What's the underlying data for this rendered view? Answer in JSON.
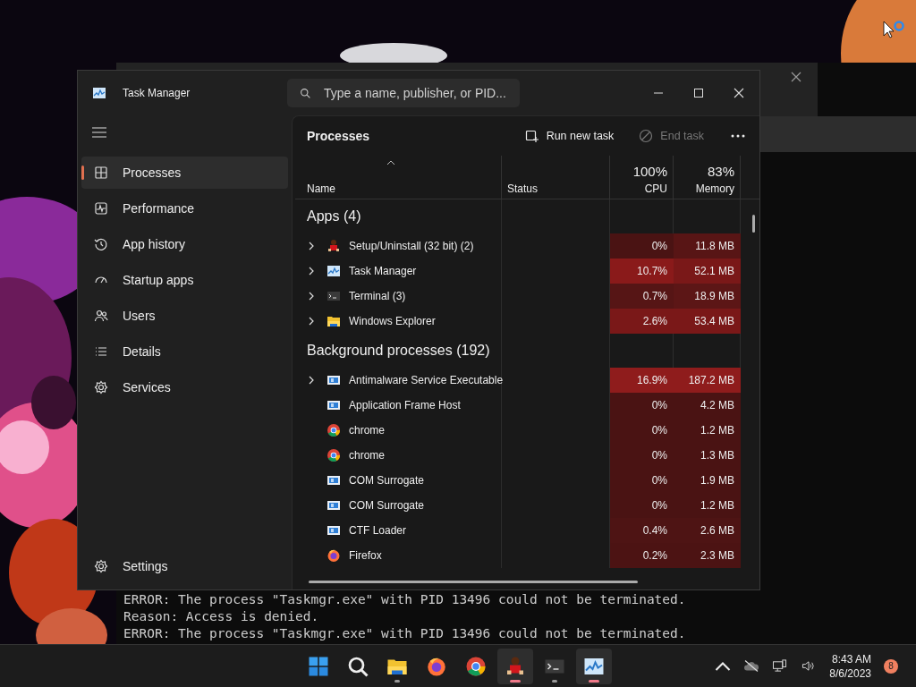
{
  "terminal": {
    "lines": [
      "ERROR: The process \"Taskmgr.exe\" with PID 13496 could not be terminated.",
      "Reason: Access is denied.",
      "ERROR: The process \"Taskmgr.exe\" with PID 13496 could not be terminated."
    ]
  },
  "task_manager": {
    "title": "Task Manager",
    "search": {
      "placeholder": "Type a name, publisher, or PID..."
    },
    "sidebar": {
      "items": [
        {
          "kind": "processes",
          "label": "Processes",
          "selected": true
        },
        {
          "kind": "performance",
          "label": "Performance",
          "selected": false
        },
        {
          "kind": "history",
          "label": "App history",
          "selected": false
        },
        {
          "kind": "startup",
          "label": "Startup apps",
          "selected": false
        },
        {
          "kind": "users",
          "label": "Users",
          "selected": false
        },
        {
          "kind": "details",
          "label": "Details",
          "selected": false
        },
        {
          "kind": "services",
          "label": "Services",
          "selected": false
        }
      ],
      "settings": "Settings"
    },
    "page_title": "Processes",
    "toolbar": [
      {
        "kind": "run",
        "label": "Run new task",
        "disabled": false
      },
      {
        "kind": "end",
        "label": "End task",
        "disabled": true
      }
    ],
    "table": {
      "columns": [
        "Name",
        "Status",
        "CPU",
        "Memory"
      ],
      "cpu_total": "100%",
      "memory_total": "83%",
      "groups": [
        {
          "title": "Apps (4)",
          "rows": [
            {
              "kind": "setup",
              "name": "Setup/Uninstall (32 bit) (2)",
              "expandable": true,
              "cpu": {
                "value": "0%",
                "color": "#4a1313"
              },
              "memory": {
                "value": "11.8 MB",
                "color": "#581515"
              }
            },
            {
              "kind": "taskmgr",
              "name": "Task Manager",
              "expandable": true,
              "cpu": {
                "value": "10.7%",
                "color": "#8a1a1a"
              },
              "memory": {
                "value": "52.1 MB",
                "color": "#7a1818"
              }
            },
            {
              "kind": "terminal",
              "name": "Terminal (3)",
              "expandable": true,
              "cpu": {
                "value": "0.7%",
                "color": "#561515"
              },
              "memory": {
                "value": "18.9 MB",
                "color": "#5c1616"
              }
            },
            {
              "kind": "folder",
              "name": "Windows Explorer",
              "expandable": true,
              "cpu": {
                "value": "2.6%",
                "color": "#7a1818"
              },
              "memory": {
                "value": "53.4 MB",
                "color": "#7a1818"
              }
            }
          ]
        },
        {
          "title": "Background processes (192)",
          "rows": [
            {
              "kind": "service",
              "name": "Antimalware Service Executable",
              "expandable": true,
              "cpu": {
                "value": "16.9%",
                "color": "#8f1c1c"
              },
              "memory": {
                "value": "187.2 MB",
                "color": "#8f1c1c"
              }
            },
            {
              "kind": "service",
              "name": "Application Frame Host",
              "expandable": false,
              "cpu": {
                "value": "0%",
                "color": "#4a1313"
              },
              "memory": {
                "value": "4.2 MB",
                "color": "#4a1313"
              }
            },
            {
              "kind": "chrome",
              "name": "chrome",
              "expandable": false,
              "cpu": {
                "value": "0%",
                "color": "#4a1313"
              },
              "memory": {
                "value": "1.2 MB",
                "color": "#4a1313"
              }
            },
            {
              "kind": "chrome",
              "name": "chrome",
              "expandable": false,
              "cpu": {
                "value": "0%",
                "color": "#4a1313"
              },
              "memory": {
                "value": "1.3 MB",
                "color": "#4a1313"
              }
            },
            {
              "kind": "service",
              "name": "COM Surrogate",
              "expandable": false,
              "cpu": {
                "value": "0%",
                "color": "#4a1313"
              },
              "memory": {
                "value": "1.9 MB",
                "color": "#4a1313"
              }
            },
            {
              "kind": "service",
              "name": "COM Surrogate",
              "expandable": false,
              "cpu": {
                "value": "0%",
                "color": "#4a1313"
              },
              "memory": {
                "value": "1.2 MB",
                "color": "#4a1313"
              }
            },
            {
              "kind": "service",
              "name": "CTF Loader",
              "expandable": false,
              "cpu": {
                "value": "0.4%",
                "color": "#4e1414"
              },
              "memory": {
                "value": "2.6 MB",
                "color": "#4e1414"
              }
            },
            {
              "kind": "firefox",
              "name": "Firefox",
              "expandable": false,
              "cpu": {
                "value": "0.2%",
                "color": "#4c1313"
              },
              "memory": {
                "value": "2.3 MB",
                "color": "#4c1313"
              }
            }
          ]
        }
      ]
    }
  },
  "taskbar": {
    "apps": [
      {
        "kind": "start",
        "running": false,
        "selected": false
      },
      {
        "kind": "search",
        "running": false,
        "selected": false
      },
      {
        "kind": "folder",
        "running": true,
        "selected": false
      },
      {
        "kind": "firefox",
        "running": false,
        "selected": false
      },
      {
        "kind": "chrome",
        "running": false,
        "selected": false
      },
      {
        "kind": "setup",
        "running": true,
        "selected": true
      },
      {
        "kind": "terminal",
        "running": true,
        "selected": false
      },
      {
        "kind": "taskmgr",
        "running": true,
        "selected": true
      }
    ],
    "time": "8:43 AM",
    "date": "8/6/2023",
    "notifications": "8"
  }
}
